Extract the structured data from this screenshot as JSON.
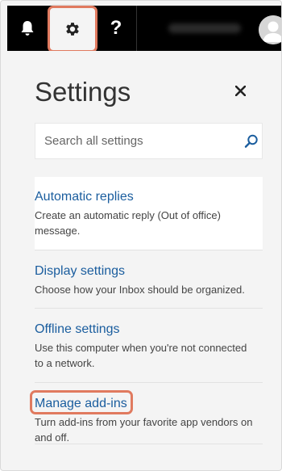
{
  "topbar": {
    "bell_icon": "bell-icon",
    "gear_icon": "gear-icon",
    "help_icon": "question-mark-icon",
    "help_label": "?",
    "avatar_icon": "person-avatar-icon"
  },
  "settings": {
    "title": "Settings",
    "close_icon": "close-icon",
    "close_label": "×",
    "search": {
      "placeholder": "Search all settings",
      "icon": "search-icon"
    },
    "sections": [
      {
        "link": "Automatic replies",
        "description": "Create an automatic reply (Out of office) message."
      },
      {
        "link": "Display settings",
        "description": "Choose how your Inbox should be organized."
      },
      {
        "link": "Offline settings",
        "description": "Use this computer when you're not connected to a network."
      },
      {
        "link": "Manage add-ins",
        "description": "Turn add-ins from your favorite app vendors on and off."
      }
    ]
  },
  "colors": {
    "topbar_bg": "#000000",
    "panel_bg": "#f4f4f4",
    "link": "#1a5d9e",
    "highlight": "#e07a5f"
  }
}
